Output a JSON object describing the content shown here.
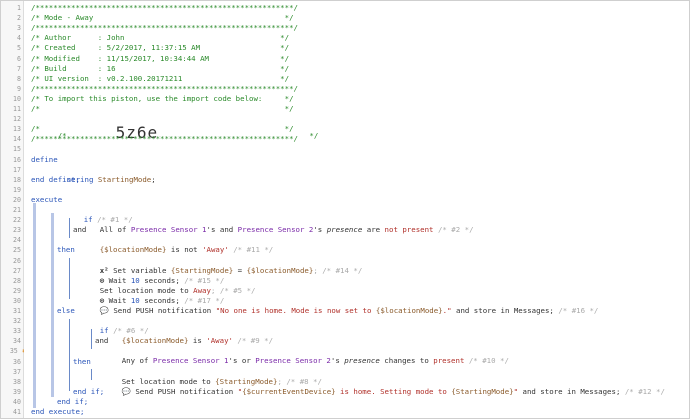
{
  "editor": {
    "line_numbers": [
      "1",
      "2",
      "3",
      "4",
      "5",
      "6",
      "7",
      "8",
      "9",
      "10",
      "11",
      "12",
      "13",
      "14",
      "15",
      "16",
      "17",
      "18",
      "19",
      "20",
      "21",
      "22",
      "23",
      "24",
      "25",
      "26",
      "27",
      "28",
      "29",
      "30",
      "31",
      "32",
      "33",
      "34",
      "35",
      "36",
      "37",
      "38",
      "39",
      "40",
      "41"
    ],
    "breakpoint_line": "35",
    "header": {
      "border": "/**********************************************************/",
      "title": "/* Mode - Away                                           */",
      "author": "/* Author      : John                                   */",
      "created": "/* Created     : 5/2/2017, 11:37:15 AM                  */",
      "modified": "/* Modified    : 11/15/2017, 10:34:44 AM                */",
      "build": "/* Build       : 16                                     */",
      "ui_version": "/* UI version  : v0.2.100.20171211                      */",
      "import_note": "/* To import this piston, use the import code below:     */",
      "blank": "/*                                                       */",
      "code_prefix": "/*           ",
      "import_code": "5z6e",
      "code_suffix": "                                  */"
    },
    "define": {
      "kw": "define",
      "type": "string",
      "var": "StartingMode",
      "end": "end define;"
    },
    "execute": {
      "kw": "execute",
      "if1": "if",
      "if1_comment": "/* #1 */",
      "cond1_pre": "All of ",
      "sensor1": "Presence Sensor 1",
      "cond1_mid1": "'s and ",
      "sensor2": "Presence Sensor 2",
      "cond1_mid2": "'s ",
      "presence": "presence",
      "are": " are ",
      "not_present": "not present",
      "cond1_comment": " /* #2 */",
      "and": "and",
      "location_mode": "{$locationMode}",
      "is_not": " is not ",
      "away_str": "'Away'",
      "cond2_comment": " /* #11 */",
      "then": "then",
      "set_var_icon": "x²",
      "set_var_text": "Set variable ",
      "starting_mode": "{StartingMode}",
      "eq": " = ",
      "set_var_comment": "; /* #14 */",
      "wait_icon": "⊙",
      "wait_text": "Wait ",
      "ten": "10",
      "seconds": " seconds;",
      "wait1_comment": " /* #15 */",
      "set_loc_text": "Set location mode to ",
      "away": "Away",
      "set_loc_comment": "; /* #5 */",
      "wait2_comment": " /* #17 */",
      "push_icon": "💬",
      "push_text": "Send PUSH notification ",
      "push1_msg_a": "\"No one is home. Mode is now set to ",
      "push1_msg_b": ".\"",
      "push_store": " and store in Messages;",
      "push1_comment": " /* #16 */",
      "else": "else",
      "if2": "if",
      "if2_comment": "/* #6 */",
      "is": " is ",
      "cond3_comment": " /* #9 */",
      "any_of": "Any of ",
      "or": "'s or ",
      "changes_to": " changes to ",
      "present": "present",
      "cond4_comment": " /* #10 */",
      "set_loc2_comment": "; /* #8 */",
      "push2_msg_a": "\"",
      "current_device": "{$currentEventDevice}",
      "push2_msg_b": " is home. Setting mode to ",
      "push2_msg_c": "\"",
      "push2_comment": " /* #12 */",
      "end_if_inner": "end if;",
      "end_if_outer": "end if;",
      "end_execute": "end execute;"
    }
  }
}
